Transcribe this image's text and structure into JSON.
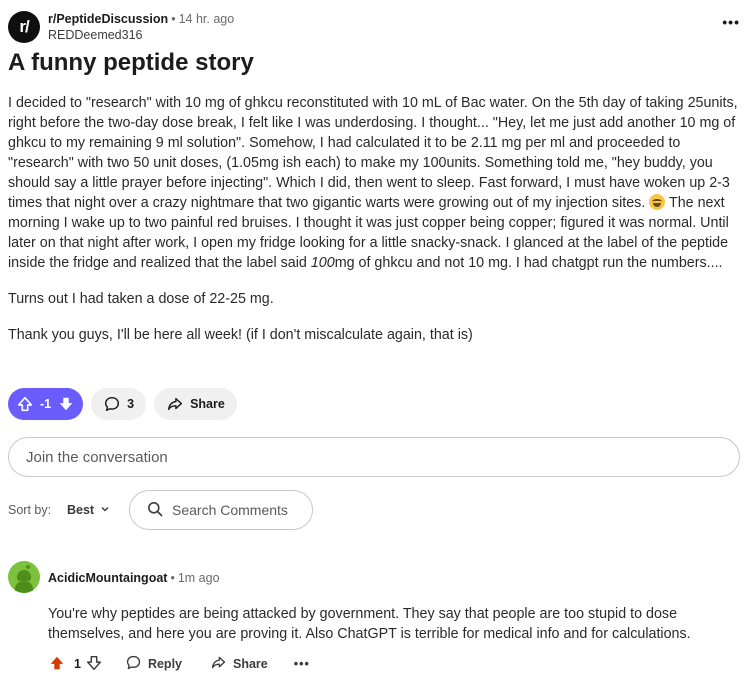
{
  "post": {
    "subreddit": "r/PeptideDiscussion",
    "subreddit_icon_text": "r/",
    "time": "14 hr. ago",
    "author": "REDDeemed316",
    "overflow": "•••",
    "title": "A funny peptide story",
    "body": {
      "p1_before_emoji": "I decided to \"research\" with 10 mg of ghkcu reconstituted with 10 mL of Bac water. On the 5th day of taking 25units, right before the two-day dose break, I felt like I was underdosing. I thought... \"Hey, let me just add another 10 mg of ghkcu to my remaining 9 ml solution\". Somehow, I had calculated it to be 2.11 mg per ml and proceeded to \"research\" with two 50 unit doses, (1.05mg ish each) to make my 100units. Something told me, \"hey buddy, you should say a little prayer before injecting\". Which I did, then went to sleep. Fast forward, I must have woken up 2-3 times that night over a crazy nightmare that two gigantic warts were growing out of my injection sites.",
      "p1_after_emoji": " The next morning I wake up to two painful red bruises. I thought it was just copper being copper; figured it was normal. Until later on that night after work, I open my fridge looking for a little snacky-snack. I glanced at the label of the peptide inside the fridge and realized that the label said ",
      "p1_emphasis": "100",
      "p1_end": "mg of ghkcu and not 10 mg. I had chatgpt run the numbers....",
      "p2": "Turns out I had taken a dose of 22-25 mg.",
      "p3": "Thank you guys, I'll be here all week! (if I don't miscalculate again, that is)"
    },
    "vote_score": "-1",
    "comment_count": "3",
    "share_label": "Share"
  },
  "join_placeholder": "Join the conversation",
  "sort": {
    "label": "Sort by:",
    "value": "Best",
    "search_placeholder": "Search Comments"
  },
  "comment": {
    "author": "AcidicMountaingoat",
    "time": "1m ago",
    "body": "You're why peptides are being attacked by government. They say that people are too stupid to dose themselves, and here you are proving it. Also ChatGPT is terrible for medical info and for calculations.",
    "score": "1",
    "reply_label": "Reply",
    "share_label": "Share",
    "overflow": "•••"
  },
  "colors": {
    "vote_accent": "#6a5cff",
    "upvote_orange": "#d93a00",
    "avatar_green": "#7dc23e"
  }
}
